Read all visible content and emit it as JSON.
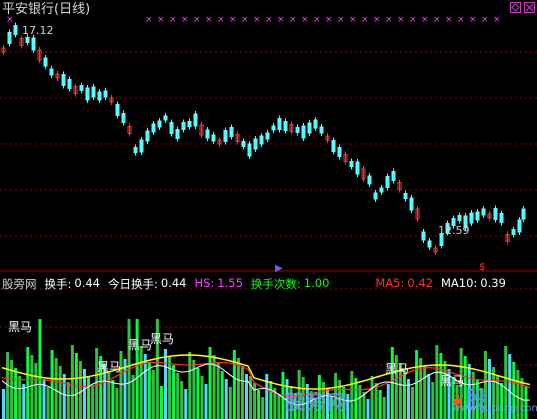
{
  "title": "平安银行(日线)",
  "high_label": "17.12",
  "low_label": "12.59",
  "indicator": {
    "name": "股旁网",
    "hs_label": "换手:",
    "hs_value": "0.44",
    "today_label": "今日换手:",
    "today_value": "0.44",
    "hs2_label": "HS:",
    "hs2_value": "1.55",
    "times_label": "换手次数:",
    "times_value": "1.00",
    "ma5_label": "MA5:",
    "ma5_value": "0.42",
    "ma10_label": "MA10:",
    "ma10_value": "0.39"
  },
  "heima_label": "黑马",
  "watermark": "股旁网",
  "watermark_logo": "股",
  "watermark_url": "www.gupang.com",
  "icons": [
    "restore-icon",
    "close-icon"
  ],
  "colors": {
    "up": "#ff3232",
    "down": "#54ffff",
    "grid": "#8b0000",
    "magenta": "#ff40ff",
    "white": "#ffffff",
    "yellow": "#ffff00",
    "green": "#00ff00",
    "red": "#ff3030"
  }
}
